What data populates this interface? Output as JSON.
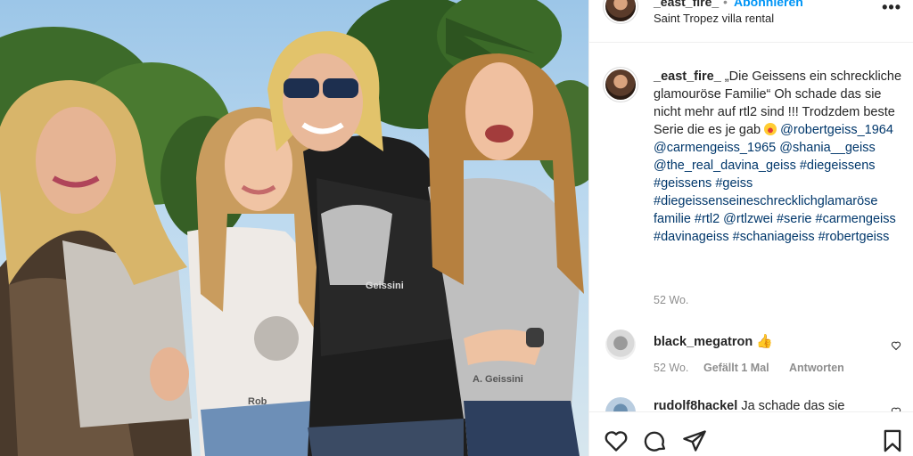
{
  "post": {
    "username": "_east_fire_",
    "separator": "•",
    "follow_label": "Abonnieren",
    "location": "Saint Tropez villa rental",
    "more_label": "•••"
  },
  "photo": {
    "shirt_text_left": "Rob",
    "shirt_text_dad": "Geissini",
    "shirt_text_right": "A. Geissini"
  },
  "caption": {
    "username": "_east_fire_",
    "text_1": " „Die Geissens ein schreckliche glamouröse Familie“ Oh schade das sie nicht mehr auf rtl2 sind !!! Trodzdem beste Serie die es je gab ",
    "mentions": "@robertgeiss_1964 @carmengeiss_1965 @shania__geiss @the_real_davina_geiss",
    "hashtags": "#diegeissens #geissens #geiss #diegeissenseineschrecklichglamaröse familie #rtl2 @rtlzwei #serie #carmengeiss #davinageiss #schaniageiss #robertgeiss",
    "time": "52 Wo."
  },
  "comments": [
    {
      "username": "black_megatron",
      "text": "👍",
      "time": "52 Wo.",
      "likes": "Gefällt 1 Mal",
      "reply": "Antworten"
    },
    {
      "username": "rudolf8hackel",
      "text": "Ja schade das sie"
    }
  ],
  "icons": {
    "like": "heart-icon",
    "comment": "comment-icon",
    "share": "share-icon",
    "save": "bookmark-icon"
  }
}
